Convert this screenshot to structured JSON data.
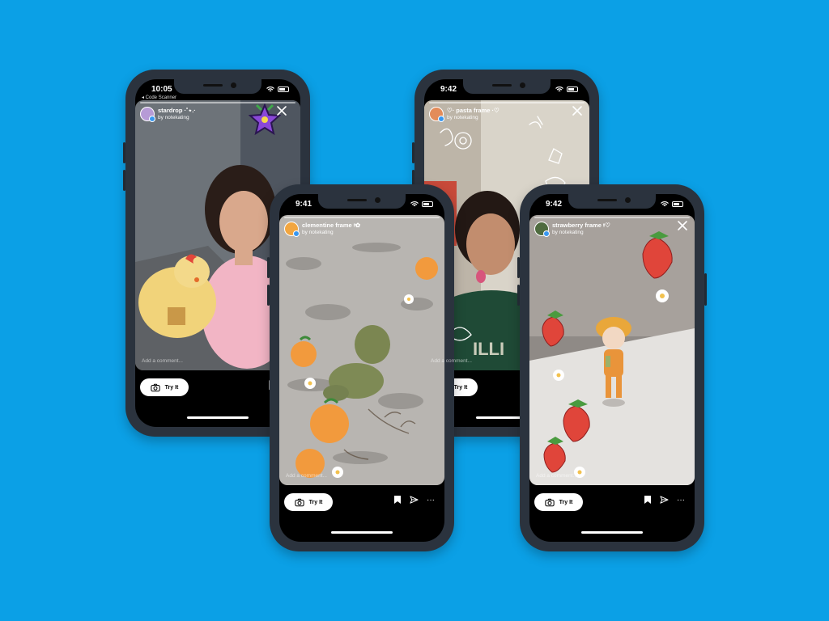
{
  "background_color": "#0ba0e6",
  "phones": [
    {
      "time": "10:05",
      "back_label": "◂ Code Scanner",
      "filter_name": "stardrop ·˚⋆.·",
      "author": "by notekating",
      "comment_placeholder": "Add a comment...",
      "try_label": "Try It"
    },
    {
      "time": "9:41",
      "filter_name": "clementine frame ᵎᵎ✿",
      "author": "by notekating",
      "comment_placeholder": "Add a comment...",
      "try_label": "Try It"
    },
    {
      "time": "9:42",
      "filter_name": "♡· pasta frame ·♡",
      "author": "by notekating",
      "comment_placeholder": "Add a comment...",
      "try_label": "Try It"
    },
    {
      "time": "9:42",
      "filter_name": "strawberry frame ᵎᵎ♡",
      "author": "by notekating",
      "comment_placeholder": "Add a comment...",
      "try_label": "Try It"
    }
  ]
}
